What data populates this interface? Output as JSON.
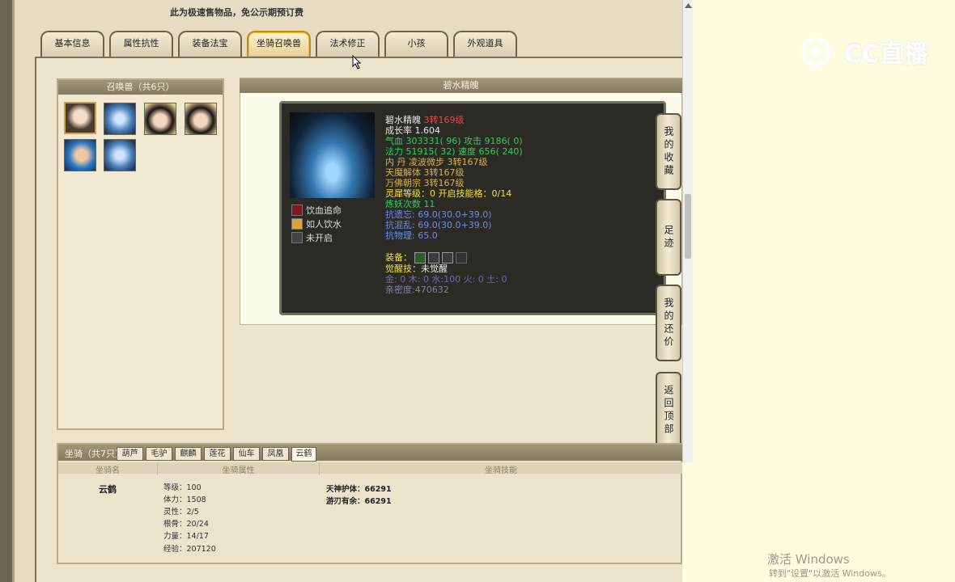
{
  "notice": "此为极速售物品，免公示期预订费",
  "tabs": [
    "基本信息",
    "属性抗性",
    "装备法宝",
    "坐骑召唤兽",
    "法术修正",
    "小孩",
    "外观道具"
  ],
  "pets": {
    "title": "召唤兽（共6只）"
  },
  "detail": {
    "title": "碧水精魄",
    "name": "碧水精魄",
    "level": "3转169级",
    "lines": [
      {
        "text": "成长率 1.604",
        "color": "#e8e8e8"
      },
      {
        "text": "气血 303331( 96) 攻击 9186( 0)",
        "color": "#2fd05a"
      },
      {
        "text": "法力 51915( 32) 速度 656( 240)",
        "color": "#2fd05a"
      },
      {
        "text": "内    丹 凌波微步 3转167级",
        "color": "#d8b248"
      },
      {
        "text": "            天魔解体 3转167级",
        "color": "#d8b248"
      },
      {
        "text": "            万佛朝宗 3转167级",
        "color": "#d8b248"
      },
      {
        "text": "灵犀等级：0 开启技能格：0/14",
        "color": "#f2e23a"
      },
      {
        "text": "炼妖次数 11",
        "color": "#2fd05a"
      },
      {
        "text": "抗遗忘: 69.0(30.0+39.0)",
        "color": "#6a8df7"
      },
      {
        "text": "抗混乱: 69.0(30.0+39.0)",
        "color": "#6a8df7"
      },
      {
        "text": "抗物理: 65.0",
        "color": "#6a8df7"
      }
    ],
    "skills": [
      "饮血追命",
      "如人饮水",
      "未开启"
    ],
    "equip_label": "装备：",
    "awaken_label": "觉醒技：",
    "awaken_value": "未觉醒",
    "elements": "金: 0 木: 0 水:100 火: 0 土: 0",
    "intimacy": "亲密度:470632"
  },
  "side_buttons": [
    "我的收藏",
    "足迹",
    "我的还价",
    "返回顶部"
  ],
  "mounts": {
    "title": "坐骑（共7只）",
    "tabs": [
      "葫芦",
      "毛驴",
      "麒麟",
      "莲花",
      "仙车",
      "凤凰",
      "云鹤"
    ],
    "col_name": "坐骑名",
    "col_attr": "坐骑属性",
    "col_skill": "坐骑技能",
    "name": "云鹤",
    "stats": [
      "等级：100",
      "体力：1508",
      "灵性：2/5",
      "根骨：20/24",
      "力量：14/17",
      "经验：207120"
    ],
    "skills": [
      "天神护体：66291",
      "游刃有余：66291"
    ]
  },
  "watermark": "CC直播",
  "activate": {
    "line1": "激活 Windows",
    "line2": "转到\"设置\"以激活 Windows。"
  }
}
